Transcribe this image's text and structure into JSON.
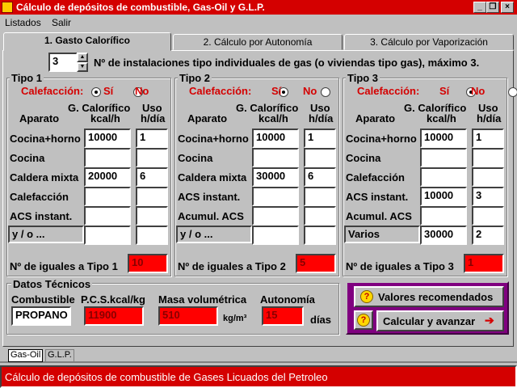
{
  "window": {
    "title": "Cálculo de depósitos de combustible, Gas-Oil y G.L.P."
  },
  "menu": {
    "items": [
      "Listados",
      "Salir"
    ]
  },
  "tabs": [
    "1. Gasto Calorífico",
    "2. Cálculo por Autonomía",
    "3. Cálculo por Vaporización"
  ],
  "installs": {
    "value": "3",
    "label": "Nº de instalaciones tipo individuales de gas (o viviendas tipo gas), máximo 3."
  },
  "types": [
    {
      "title": "Tipo 1",
      "calef_label": "Calefacción:",
      "si": "Sí",
      "no": "No",
      "head_aparato": "Aparato",
      "head_gcal": "G. Calorífico",
      "head_gcal2": "kcal/h",
      "head_uso": "Uso",
      "head_uso2": "h/día",
      "rows": [
        {
          "name": "Cocina+horno",
          "kcal": "10000",
          "uso": "1"
        },
        {
          "name": "Cocina",
          "kcal": "",
          "uso": ""
        },
        {
          "name": "Caldera mixta",
          "kcal": "20000",
          "uso": "6"
        },
        {
          "name": "Calefacción",
          "kcal": "",
          "uso": ""
        },
        {
          "name": "ACS instant.",
          "kcal": "",
          "uso": ""
        },
        {
          "name": "y / o ...",
          "kcal": "",
          "uso": ""
        }
      ],
      "iguales_label": "Nº de iguales a Tipo 1",
      "iguales": "10"
    },
    {
      "title": "Tipo 2",
      "calef_label": "Calefacción:",
      "si": "Sí",
      "no": "No",
      "head_aparato": "Aparato",
      "head_gcal": "G. Calorífico",
      "head_gcal2": "kcal/h",
      "head_uso": "Uso",
      "head_uso2": "h/día",
      "rows": [
        {
          "name": "Cocina+horno",
          "kcal": "10000",
          "uso": "1"
        },
        {
          "name": "Cocina",
          "kcal": "",
          "uso": ""
        },
        {
          "name": "Caldera mixta",
          "kcal": "30000",
          "uso": "6"
        },
        {
          "name": "ACS instant.",
          "kcal": "",
          "uso": ""
        },
        {
          "name": "Acumul. ACS",
          "kcal": "",
          "uso": ""
        },
        {
          "name": "y / o ...",
          "kcal": "",
          "uso": ""
        }
      ],
      "iguales_label": "Nº de iguales a Tipo 2",
      "iguales": "5"
    },
    {
      "title": "Tipo 3",
      "calef_label": "Calefacción:",
      "si": "Sí",
      "no": "No",
      "head_aparato": "Aparato",
      "head_gcal": "G. Calorífico",
      "head_gcal2": "kcal/h",
      "head_uso": "Uso",
      "head_uso2": "h/día",
      "rows": [
        {
          "name": "Cocina+horno",
          "kcal": "10000",
          "uso": "1"
        },
        {
          "name": "Cocina",
          "kcal": "",
          "uso": ""
        },
        {
          "name": "Calefacción",
          "kcal": "",
          "uso": ""
        },
        {
          "name": "ACS instant.",
          "kcal": "10000",
          "uso": "3"
        },
        {
          "name": "Acumul. ACS",
          "kcal": "",
          "uso": ""
        },
        {
          "name": "Varios",
          "kcal": "30000",
          "uso": "2"
        }
      ],
      "iguales_label": "Nº de iguales a Tipo 3",
      "iguales": "1"
    }
  ],
  "datos": {
    "title": "Datos Técnicos",
    "combustible_label": "Combustible",
    "combustible": "PROPANO",
    "pcs_label": "P.C.S.kcal/kg",
    "pcs": "11900",
    "masa_label": "Masa volumétrica",
    "masa": "510",
    "masa_unit": "kg/m³",
    "autonomia_label": "Autonomía",
    "autonomia": "15",
    "autonomia_unit": "días"
  },
  "buttons": {
    "recomendados": "Valores recomendados",
    "calcular": "Calcular y avanzar"
  },
  "bottom_tabs": [
    "Gas-Oil",
    "G.L.P."
  ],
  "status": "Cálculo de depósitos de combustible de Gases Licuados del Petroleo",
  "colors": {
    "title_bg": "#d40000",
    "field_red": "#ff0000",
    "purple": "#800080"
  }
}
